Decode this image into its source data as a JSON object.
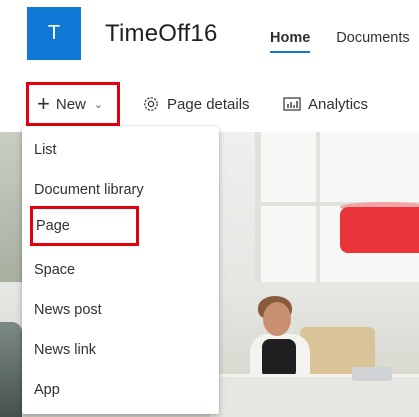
{
  "site": {
    "logo_letter": "T",
    "title": "TimeOff16",
    "brand_color": "#0f78d4"
  },
  "nav": {
    "items": [
      {
        "label": "Home",
        "active": true
      },
      {
        "label": "Documents",
        "active": false
      }
    ]
  },
  "commandbar": {
    "new_label": "New",
    "new_icon": "plus-icon",
    "new_chevron": "chevron-down-icon",
    "page_details_label": "Page details",
    "page_details_icon": "gear-icon",
    "analytics_label": "Analytics",
    "analytics_icon": "analytics-icon"
  },
  "new_menu": {
    "items": [
      {
        "label": "List"
      },
      {
        "label": "Document library"
      },
      {
        "label": "Page",
        "highlighted": true
      },
      {
        "label": "Space"
      },
      {
        "label": "News post"
      },
      {
        "label": "News link"
      },
      {
        "label": "App"
      }
    ]
  },
  "annotation_color": "#e3000f"
}
